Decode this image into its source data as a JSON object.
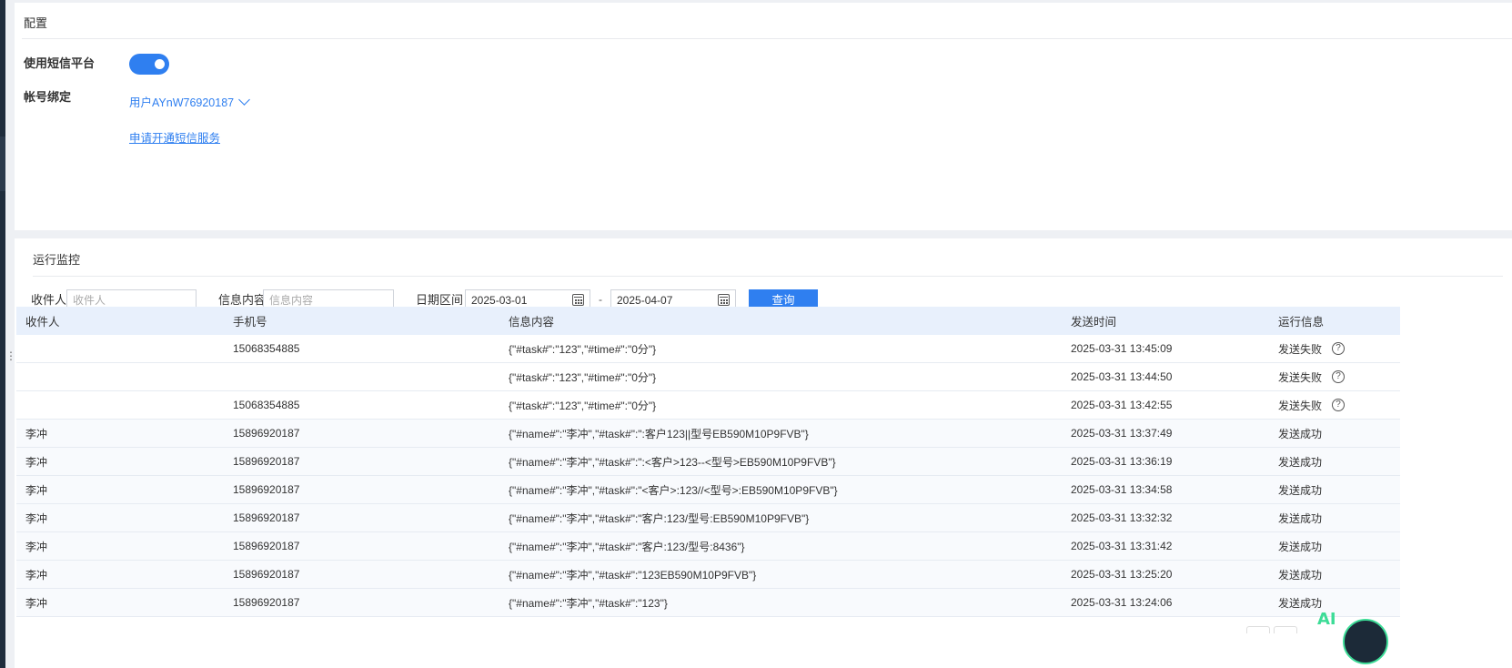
{
  "config": {
    "title": "配置",
    "sms_label": "使用短信平台",
    "sms_enabled": true,
    "account_label": "帐号绑定",
    "account_value": "用户AYnW76920187",
    "apply_link": "申请开通短信服务"
  },
  "monitor": {
    "title": "运行监控",
    "filters": {
      "recipient_label": "收件人",
      "recipient_placeholder": "收件人",
      "content_label": "信息内容",
      "content_placeholder": "信息内容",
      "date_label": "日期区间",
      "date_start": "2025-03-01",
      "date_sep": "-",
      "date_end": "2025-04-07",
      "query_button": "查询"
    },
    "table": {
      "headers": [
        "收件人",
        "手机号",
        "信息内容",
        "发送时间",
        "运行信息"
      ],
      "rows": [
        {
          "recipient": "",
          "phone": "15068354885",
          "content": "{\"#task#\":\"123\",\"#time#\":\"0分\"}",
          "time": "2025-03-31 13:45:09",
          "status": "发送失败",
          "help": true
        },
        {
          "recipient": "",
          "phone": "",
          "content": "{\"#task#\":\"123\",\"#time#\":\"0分\"}",
          "time": "2025-03-31 13:44:50",
          "status": "发送失败",
          "help": true
        },
        {
          "recipient": "",
          "phone": "15068354885",
          "content": "{\"#task#\":\"123\",\"#time#\":\"0分\"}",
          "time": "2025-03-31 13:42:55",
          "status": "发送失败",
          "help": true
        },
        {
          "recipient": "李冲",
          "phone": "15896920187",
          "content": "{\"#name#\":\"李冲\",\"#task#\":\":客户123||型号EB590M10P9FVB\"}",
          "time": "2025-03-31 13:37:49",
          "status": "发送成功",
          "help": false
        },
        {
          "recipient": "李冲",
          "phone": "15896920187",
          "content": "{\"#name#\":\"李冲\",\"#task#\":\":<客户>123--<型号>EB590M10P9FVB\"}",
          "time": "2025-03-31 13:36:19",
          "status": "发送成功",
          "help": false
        },
        {
          "recipient": "李冲",
          "phone": "15896920187",
          "content": "{\"#name#\":\"李冲\",\"#task#\":\"<客户>:123//<型号>:EB590M10P9FVB\"}",
          "time": "2025-03-31 13:34:58",
          "status": "发送成功",
          "help": false
        },
        {
          "recipient": "李冲",
          "phone": "15896920187",
          "content": "{\"#name#\":\"李冲\",\"#task#\":\"客户:123/型号:EB590M10P9FVB\"}",
          "time": "2025-03-31 13:32:32",
          "status": "发送成功",
          "help": false
        },
        {
          "recipient": "李冲",
          "phone": "15896920187",
          "content": "{\"#name#\":\"李冲\",\"#task#\":\"客户:123/型号:8436\"}",
          "time": "2025-03-31 13:31:42",
          "status": "发送成功",
          "help": false
        },
        {
          "recipient": "李冲",
          "phone": "15896920187",
          "content": "{\"#name#\":\"李冲\",\"#task#\":\"123EB590M10P9FVB\"}",
          "time": "2025-03-31 13:25:20",
          "status": "发送成功",
          "help": false
        },
        {
          "recipient": "李冲",
          "phone": "15896920187",
          "content": "{\"#name#\":\"李冲\",\"#task#\":\"123\"}",
          "time": "2025-03-31 13:24:06",
          "status": "发送成功",
          "help": false
        }
      ]
    }
  },
  "widgets": {
    "ai_badge": "AI"
  },
  "colors": {
    "accent": "#2f7ff0",
    "header_bg": "#e8f0fc",
    "ai_green": "#3ddc97"
  }
}
